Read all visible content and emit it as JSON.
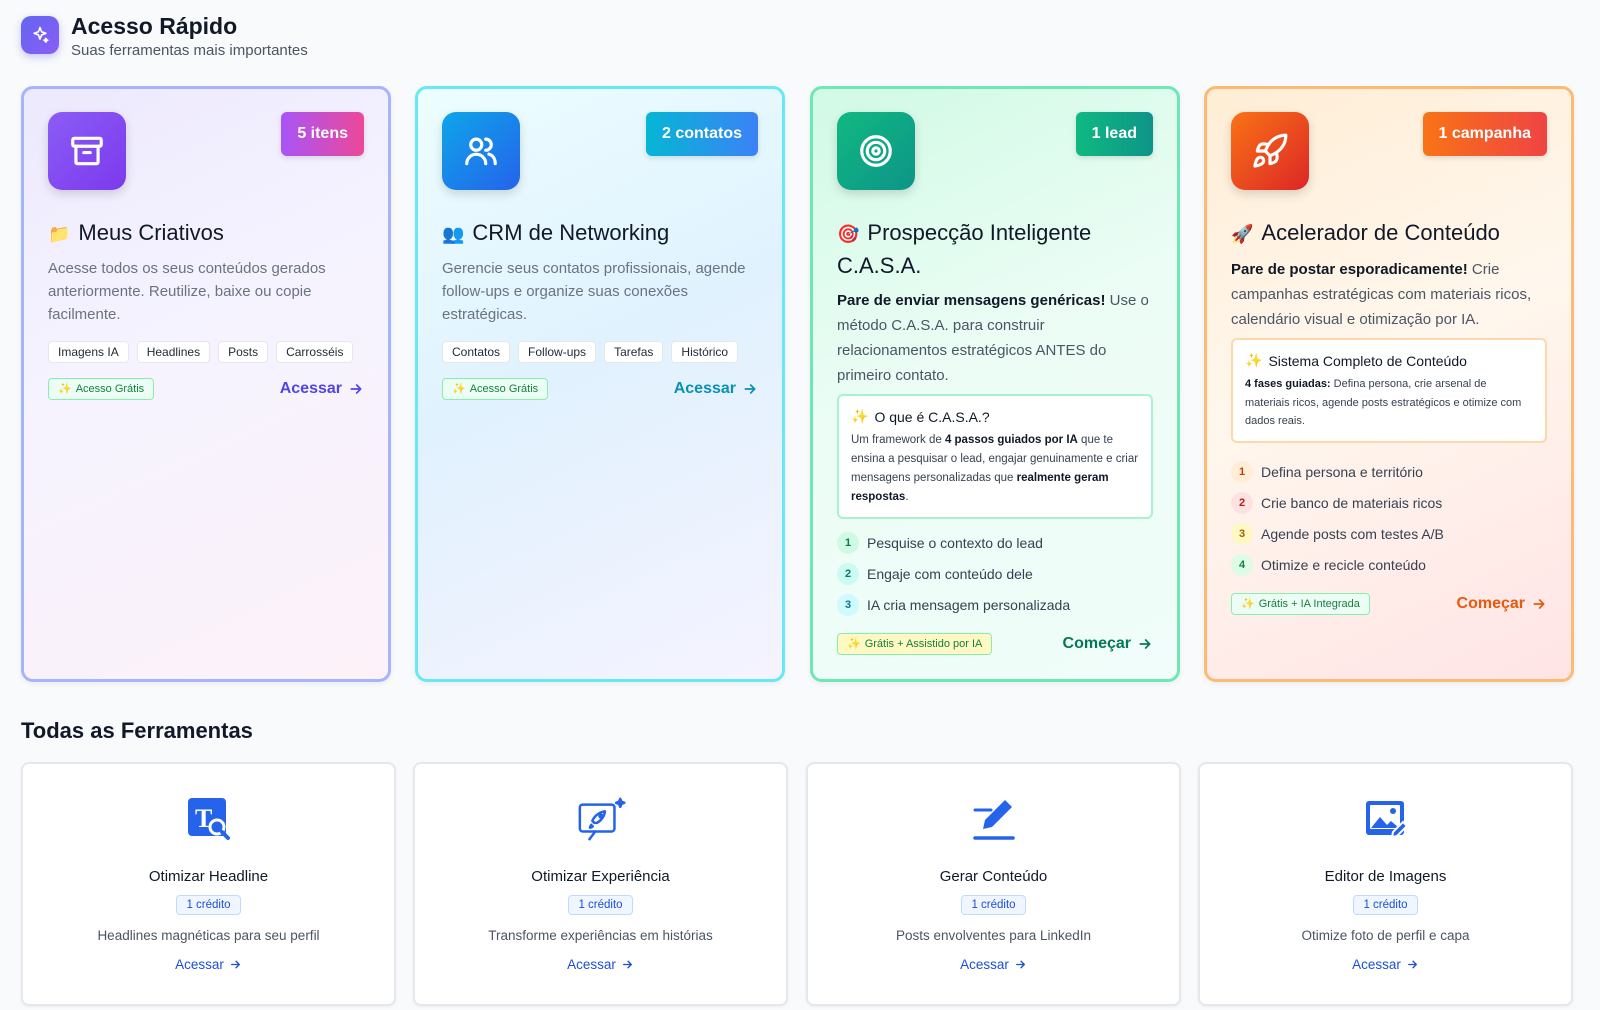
{
  "header": {
    "title": "Acesso Rápido",
    "subtitle": "Suas ferramentas mais importantes"
  },
  "quick_cards": [
    {
      "icon": "archive-icon",
      "badge": "5 itens",
      "emoji": "📁",
      "title": "Meus Criativos",
      "description": "Acesse todos os seus conteúdos gerados anteriormente. Reutilize, baixe ou copie facilmente.",
      "tags": [
        "Imagens IA",
        "Headlines",
        "Posts",
        "Carrosséis"
      ],
      "free_badge": "Acesso Grátis",
      "action": "Acessar",
      "accent": "#4f46e5"
    },
    {
      "icon": "users-icon",
      "badge": "2 contatos",
      "emoji": "👥",
      "title": "CRM de Networking",
      "description": "Gerencie seus contatos profissionais, agende follow-ups e organize suas conexões estratégicas.",
      "tags": [
        "Contatos",
        "Follow-ups",
        "Tarefas",
        "Histórico"
      ],
      "free_badge": "Acesso Grátis",
      "action": "Acessar",
      "accent": "#0891b2"
    },
    {
      "icon": "target-icon",
      "badge": "1 lead",
      "emoji": "🎯",
      "title": "Prospecção Inteligente C.A.S.A.",
      "desc_bold": "Pare de enviar mensagens genéricas!",
      "desc_rest": " Use o método C.A.S.A. para construir relacionamentos estratégicos ANTES do primeiro contato.",
      "info_title": "O que é C.A.S.A.?",
      "info_text_1": "Um framework de ",
      "info_bold_1": "4 passos guiados por IA",
      "info_text_2": " que te ensina a pesquisar o lead, engajar genuinamente e criar mensagens personalizadas que ",
      "info_bold_2": "realmente geram respostas",
      "info_text_3": ".",
      "steps": [
        {
          "n": "1",
          "text": "Pesquise o contexto do lead"
        },
        {
          "n": "2",
          "text": "Engaje com conteúdo dele"
        },
        {
          "n": "3",
          "text": "IA cria mensagem personalizada"
        }
      ],
      "free_badge": "Grátis + Assistido por IA",
      "action": "Começar",
      "accent": "#047857"
    },
    {
      "icon": "rocket-icon",
      "badge": "1 campanha",
      "emoji": "🚀",
      "title": "Acelerador de Conteúdo",
      "desc_bold": "Pare de postar esporadicamente!",
      "desc_rest": " Crie campanhas estratégicas com materiais ricos, calendário visual e otimização por IA.",
      "info_title": "Sistema Completo de Conteúdo",
      "info_bold_1": "4 fases guiadas:",
      "info_text_2": " Defina persona, crie arsenal de materiais ricos, agende posts estratégicos e otimize com dados reais.",
      "steps": [
        {
          "n": "1",
          "text": "Defina persona e território"
        },
        {
          "n": "2",
          "text": "Crie banco de materiais ricos"
        },
        {
          "n": "3",
          "text": "Agende posts com testes A/B"
        },
        {
          "n": "4",
          "text": "Otimize e recicle conteúdo"
        }
      ],
      "free_badge": "Grátis + IA Integrada",
      "action": "Começar",
      "accent": "#ea580c"
    }
  ],
  "tools_section": {
    "title": "Todas as Ferramentas",
    "tools": [
      {
        "icon": "text-search-icon",
        "name": "Otimizar Headline",
        "credit": "1 crédito",
        "description": "Headlines magnéticas para seu perfil",
        "action": "Acessar"
      },
      {
        "icon": "rocket-sparkle-icon",
        "name": "Otimizar Experiência",
        "credit": "1 crédito",
        "description": "Transforme experiências em histórias",
        "action": "Acessar"
      },
      {
        "icon": "pen-write-icon",
        "name": "Gerar Conteúdo",
        "credit": "1 crédito",
        "description": "Posts envolventes para LinkedIn",
        "action": "Acessar"
      },
      {
        "icon": "image-edit-icon",
        "name": "Editor de Imagens",
        "credit": "1 crédito",
        "description": "Otimize foto de perfil e capa",
        "action": "Acessar"
      }
    ]
  }
}
